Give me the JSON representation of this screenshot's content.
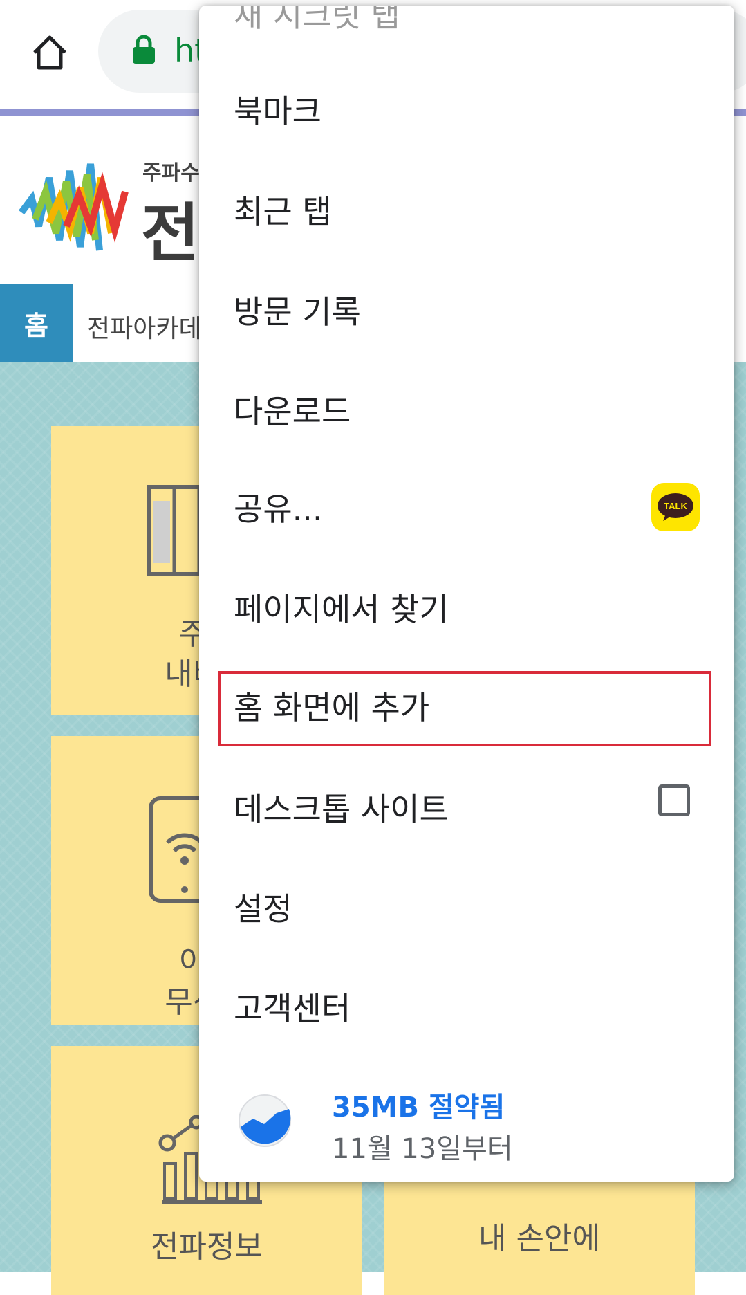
{
  "browser": {
    "url_partial": "ht"
  },
  "site": {
    "logo_small_text": "주파수",
    "logo_big_text": "전",
    "nav_home": "홈",
    "breadcrumb": "전파아카데"
  },
  "tiles": [
    {
      "line1": "주피",
      "line2": "내비ㅈ"
    },
    {
      "line1": "",
      "line2": ""
    },
    {
      "line1": "이동",
      "line2": "무선국"
    },
    {
      "line1": "",
      "line2": ""
    },
    {
      "line1": "",
      "line2": "전파정보"
    },
    {
      "line1": "",
      "line2": "내 손안에"
    }
  ],
  "menu": {
    "cut_item": "새 시크릿 탭",
    "items": [
      {
        "label": "북마크"
      },
      {
        "label": "최근 탭"
      },
      {
        "label": "방문 기록"
      },
      {
        "label": "다운로드"
      },
      {
        "label": "공유..."
      },
      {
        "label": "페이지에서 찾기"
      },
      {
        "label": "홈 화면에 추가"
      },
      {
        "label": "데스크톱 사이트"
      },
      {
        "label": "설정"
      },
      {
        "label": "고객센터"
      }
    ],
    "talk_label": "TALK",
    "desktop_site_checked": false,
    "savings": {
      "amount": "35MB 절약됨",
      "since": "11월 13일부터"
    }
  },
  "colors": {
    "highlight": "#d92b3a",
    "savings_blue": "#1a73e8",
    "nav_blue": "#2f8dbb",
    "tile_yellow": "#fde593",
    "content_bg": "#9fcfd1"
  }
}
